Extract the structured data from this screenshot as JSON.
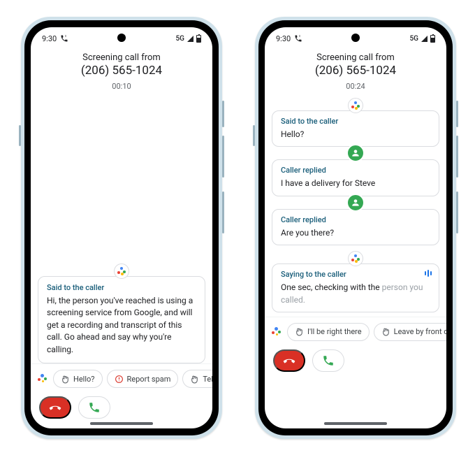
{
  "phones": [
    {
      "status": {
        "time": "9:30",
        "net": "5G"
      },
      "header": {
        "line1": "Screening call from",
        "number": "(206) 565-1024",
        "timer": "00:10"
      },
      "transcript": [
        {
          "kind": "assistant",
          "label": "Said to the caller",
          "text": "Hi, the person you've reached is using a screening service from Google, and will get a recording and transcript of this call. Go ahead and say why you're calling."
        }
      ],
      "chips": [
        {
          "icon": "waving-hand",
          "label": "Hello?"
        },
        {
          "icon": "report-spam",
          "label": "Report spam"
        },
        {
          "icon": "waving-hand",
          "label": "Tell me mo"
        }
      ]
    },
    {
      "status": {
        "time": "9:30",
        "net": "5G"
      },
      "header": {
        "line1": "Screening call from",
        "number": "(206) 565-1024",
        "timer": "00:24"
      },
      "transcript": [
        {
          "kind": "assistant",
          "label": "Said to the caller",
          "text": "Hello?"
        },
        {
          "kind": "caller",
          "label": "Caller replied",
          "text": "I have a delivery for Steve"
        },
        {
          "kind": "caller",
          "label": "Caller replied",
          "text": "Are you there?"
        },
        {
          "kind": "assistant-live",
          "label": "Saying to the caller",
          "text": "One sec, checking with the ",
          "text_muted": "person you called."
        }
      ],
      "chips": [
        {
          "icon": "waving-hand",
          "label": "I'll be right there"
        },
        {
          "icon": "waving-hand",
          "label": "Leave by front door"
        }
      ]
    }
  ]
}
